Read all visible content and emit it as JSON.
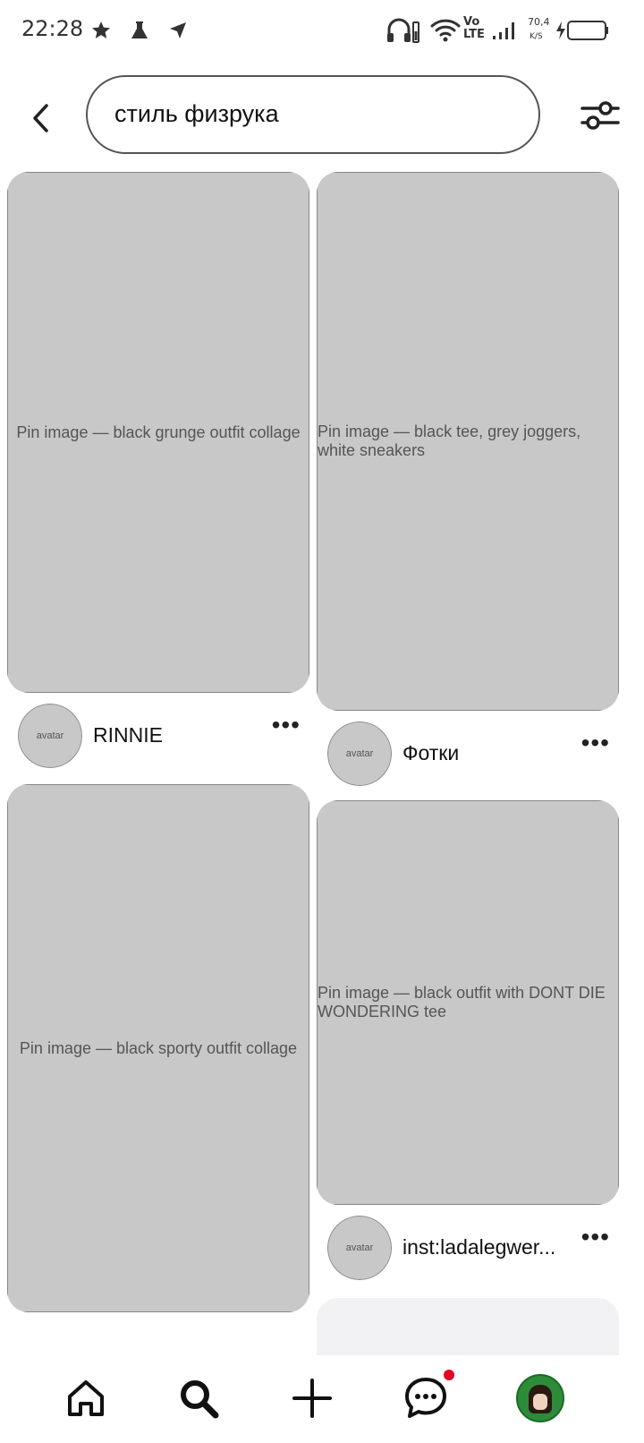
{
  "status_bar": {
    "time": "22:28",
    "left_icons": [
      "star-icon",
      "flask-icon",
      "location-arrow-icon"
    ],
    "right_icons": [
      "headphones-battery-icon",
      "wifi-icon",
      "signal-icon",
      "battery-icon"
    ],
    "network": "Vo LTE",
    "net_speed": "70,4",
    "net_speed_unit": "K/S"
  },
  "search": {
    "query": "стиль физрука",
    "back_icon": "chevron-left-icon",
    "filter_icon": "sliders-icon"
  },
  "pins": [
    {
      "image_label": "Pin image — black grunge outfit collage",
      "user": "RINNIE",
      "more": "•••"
    },
    {
      "image_label": "Pin image — black tee, grey joggers, white sneakers",
      "user": "Фотки",
      "more": "•••"
    },
    {
      "image_label": "Pin image — black sporty outfit collage",
      "user": "",
      "more": ""
    },
    {
      "image_label": "Pin image — black outfit with DONT DIE WONDERING tee",
      "user": "inst:ladalegwer...",
      "more": "•••"
    }
  ],
  "bottom_nav": [
    {
      "name": "home-icon"
    },
    {
      "name": "search-icon"
    },
    {
      "name": "create-icon"
    },
    {
      "name": "messages-icon",
      "has_badge": true
    },
    {
      "name": "profile-avatar"
    }
  ]
}
